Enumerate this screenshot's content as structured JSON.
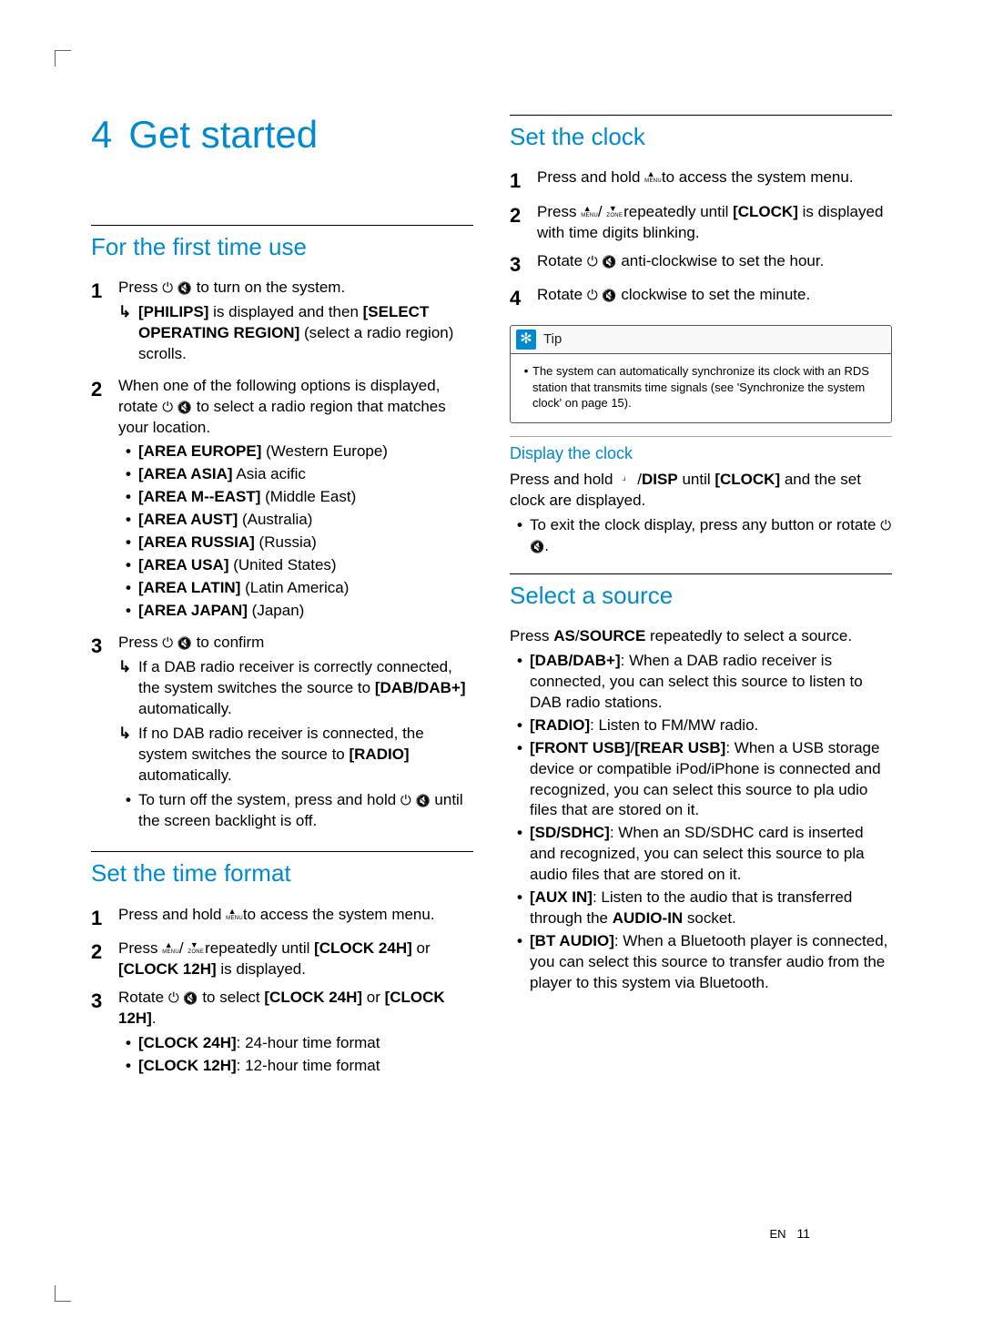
{
  "chapter": {
    "number": "4",
    "title": "Get started"
  },
  "first_use": {
    "heading": "For the first time use",
    "step1": {
      "num": "1",
      "text_a": "Press ",
      "text_b": " to turn on the system.",
      "arrow_a": "[PHILIPS]",
      "arrow_b": " is displayed and then ",
      "arrow_c": "[SELECT OPERATING REGION]",
      "arrow_d": " (select a radio region) scrolls."
    },
    "step2": {
      "num": "2",
      "text_a": "When one of the following options is displayed, rotate ",
      "text_b": " to select a radio region that matches your location.",
      "areas": [
        {
          "code": "[AREA EUROPE]",
          "desc": " (Western Europe)"
        },
        {
          "code": "[AREA ASIA]",
          "desc": "   Asia     acific "
        },
        {
          "code": "[AREA M--EAST]",
          "desc": " (Middle East)"
        },
        {
          "code": "[AREA AUST]",
          "desc": " (Australia)"
        },
        {
          "code": "[AREA RUSSIA]",
          "desc": " (Russia)"
        },
        {
          "code": "[AREA USA]",
          "desc": " (United States)"
        },
        {
          "code": "[AREA LATIN]",
          "desc": " (Latin America)"
        },
        {
          "code": "[AREA JAPAN]",
          "desc": " (Japan)"
        }
      ]
    },
    "step3": {
      "num": "3",
      "text_a": "Press ",
      "text_b": " to confirm",
      "arrow1_a": "If a DAB radio receiver is correctly connected, the system switches the source to ",
      "arrow1_b": "[DAB/DAB+]",
      "arrow1_c": " automatically.",
      "arrow2_a": "If no DAB radio receiver is connected, the system switches the source to ",
      "arrow2_b": "[RADIO]",
      "arrow2_c": " automatically.",
      "bullet_a": "To turn off the system, press and hold ",
      "bullet_b": " until the screen backlight is off."
    }
  },
  "time_format": {
    "heading": "Set the time format",
    "step1": {
      "num": "1",
      "a": "Press and hold ",
      "b": " to access the system menu."
    },
    "step2": {
      "num": "2",
      "a": "Press ",
      "b": " repeatedly until ",
      "c": "[CLOCK 24H]",
      "d": " or ",
      "e": "[CLOCK 12H]",
      "f": " is displayed."
    },
    "step3": {
      "num": "3",
      "a": "Rotate ",
      "b": " to select ",
      "c": "[CLOCK 24H]",
      "d": " or ",
      "e": "[CLOCK 12H]",
      "f": ".",
      "opts": [
        {
          "code": "[CLOCK 24H]",
          "desc": ": 24-hour time format"
        },
        {
          "code": "[CLOCK 12H]",
          "desc": ": 12-hour time format"
        }
      ]
    }
  },
  "set_clock": {
    "heading": "Set the clock",
    "step1": {
      "num": "1",
      "a": "Press and hold ",
      "b": " to access the system menu."
    },
    "step2": {
      "num": "2",
      "a": "Press ",
      "b": " repeatedly until ",
      "c": "[CLOCK]",
      "d": " is displayed with time digits blinking."
    },
    "step3": {
      "num": "3",
      "a": "Rotate ",
      "b": " anti-clockwise to set the hour."
    },
    "step4": {
      "num": "4",
      "a": "Rotate ",
      "b": " clockwise to set the minute."
    },
    "tip_label": "Tip",
    "tip_body": "The system can automatically synchronize its clock with an RDS station that transmits time signals (see 'Synchronize the system clock' on page 15)."
  },
  "display_clock": {
    "heading": "Display the clock",
    "text_a": "Press and hold ",
    "text_b": " /",
    "text_c": "DISP",
    "text_d": " until ",
    "text_e": "[CLOCK]",
    "text_f": " and the set clock are displayed.",
    "bullet_a": "To exit the clock display, press any button or rotate ",
    "bullet_b": "."
  },
  "select_source": {
    "heading": "Select a source",
    "intro_a": "Press ",
    "intro_b": "AS",
    "intro_c": "/",
    "intro_d": "SOURCE",
    "intro_e": " repeatedly to select a source.",
    "items": [
      {
        "code": "[DAB/DAB+]",
        "desc": ": When a DAB radio receiver is connected, you can select this source to listen to DAB radio stations."
      },
      {
        "code": "[RADIO]",
        "desc": ": Listen to FM/MW radio."
      },
      {
        "code": "[FRONT USB]",
        "code2": "[REAR USB]",
        "sep": "/",
        "desc": ": When a USB storage device or compatible iPod/iPhone is connected and recognized, you can select this source to pla     udio files that are stored on it."
      },
      {
        "code": "[SD/SDHC]",
        "desc": ": When an SD/SDHC card is inserted and recognized, you can select this source to pla     audio files that are stored on it."
      },
      {
        "code": "[AUX IN]",
        "desc_a": ": Listen to the audio that is transferred through the ",
        "desc_b": "AUDIO-IN",
        "desc_c": " socket."
      },
      {
        "code": "[BT AUDIO]",
        "desc": ": When a Bluetooth player is connected, you can select this source to transfer audio from the player to this system via Bluetooth."
      }
    ]
  },
  "footer": {
    "lang": "EN",
    "page": "11"
  }
}
